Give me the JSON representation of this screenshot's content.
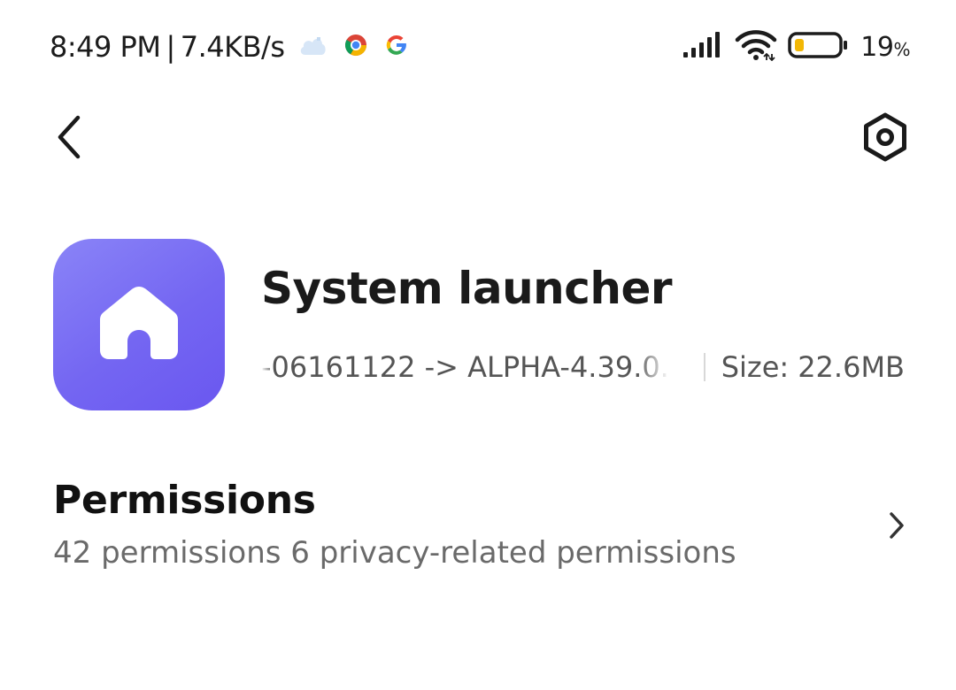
{
  "status_bar": {
    "time": "8:49 PM",
    "separator": "|",
    "network_speed": "7.4KB/s",
    "app_icons": [
      "cloud-icon",
      "chrome-icon",
      "google-icon"
    ],
    "signal_icon": "signal-bars-icon",
    "wifi_icon": "wifi-icon",
    "battery_icon": "battery-icon",
    "battery_percent": "19",
    "battery_percent_sign": "%",
    "battery_level": 0.19,
    "battery_color": "#f2b705"
  },
  "nav": {
    "back_icon": "chevron-left-icon",
    "settings_icon": "hexagon-settings-icon"
  },
  "app": {
    "name": "System launcher",
    "icon": "home-icon",
    "icon_color": "#7466f2",
    "version": "-06161122 -> ALPHA-4.39.0.",
    "size_label": "Size:",
    "size_value": "22.6MB"
  },
  "permissions": {
    "title": "Permissions",
    "summary": "42 permissions 6 privacy-related permissions",
    "chevron_icon": "chevron-right-icon"
  }
}
